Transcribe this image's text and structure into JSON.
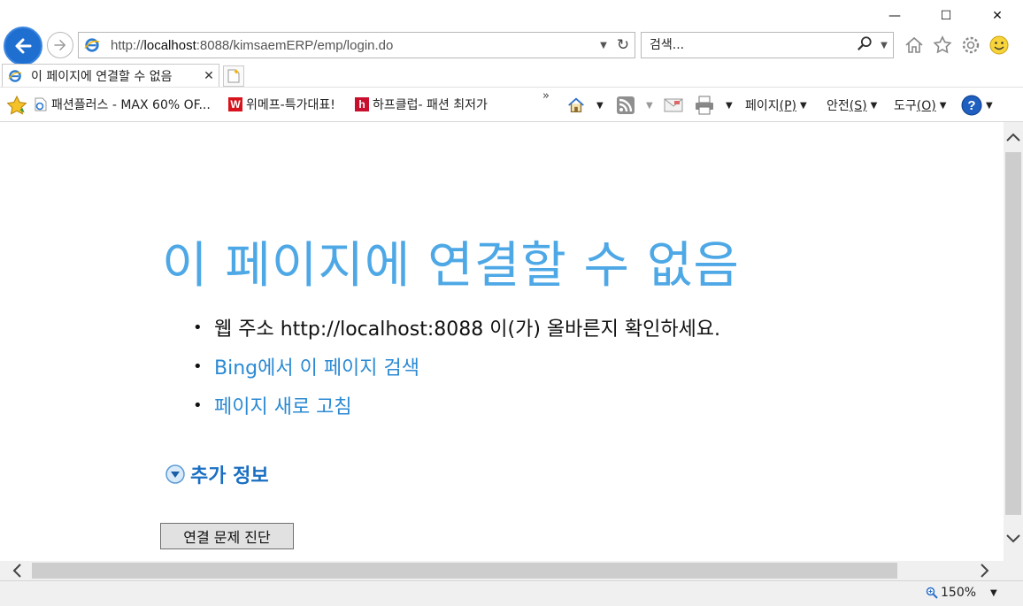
{
  "window": {
    "minimize_glyph": "—",
    "maximize_glyph": "☐",
    "close_glyph": "✕"
  },
  "nav": {
    "url_prefix": "http://",
    "url_host": "localhost",
    "url_rest": ":8088/kimsaemERP/emp/login.do",
    "search_placeholder": "검색..."
  },
  "tab": {
    "title": "이 페이지에 연결할 수 없음",
    "close_glyph": "✕"
  },
  "favorites": [
    {
      "label": "패션플러스 - MAX 60% OF...",
      "icon": "ie-page-icon",
      "badge": ""
    },
    {
      "label": "위메프-특가대표!",
      "icon": "wemakeprice-icon",
      "badge": "W",
      "color": "#d7141d"
    },
    {
      "label": "하프클럽- 패션 최저가",
      "icon": "halfclub-icon",
      "badge": "h",
      "color": "#c8102e"
    }
  ],
  "commands": {
    "page": {
      "label": "페이지",
      "key": "(P)"
    },
    "safety": {
      "label": "안전",
      "key": "(S)"
    },
    "tools": {
      "label": "도구",
      "key": "(O)"
    }
  },
  "content": {
    "title": "이 페이지에 연결할 수 없음",
    "items": [
      {
        "text": "웹 주소 http://localhost:8088 이(가) 올바른지 확인하세요.",
        "link": false
      },
      {
        "text": "Bing에서 이 페이지 검색",
        "link": true
      },
      {
        "text": "페이지 새로 고침",
        "link": true
      }
    ],
    "more_info": "추가 정보",
    "diagnose_button": "연결 문제 진단"
  },
  "status": {
    "zoom": "150%"
  },
  "colors": {
    "accent": "#4ea8e6",
    "link": "#2b8ad3",
    "back_button": "#1f6fd1"
  }
}
